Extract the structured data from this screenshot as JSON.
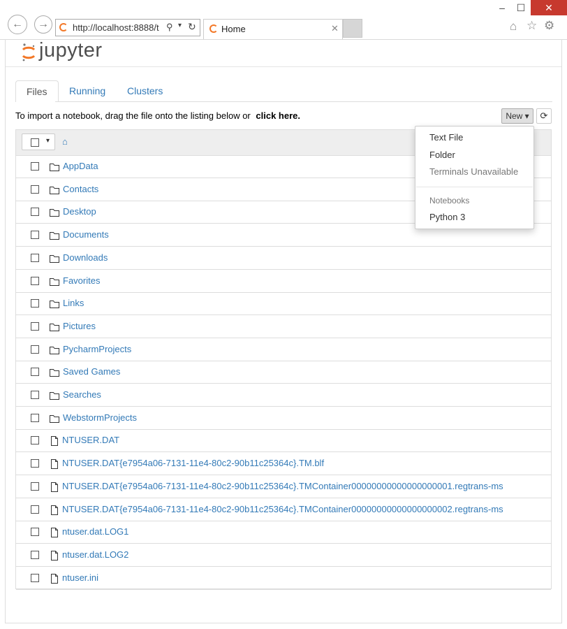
{
  "browser": {
    "address": "http://localhost:8888/t",
    "tab_title": "Home",
    "window_controls": {
      "minimize": "–",
      "maximize": "☐",
      "close": "✕"
    }
  },
  "app": {
    "logo_text": "jupyter"
  },
  "tabs": [
    {
      "label": "Files"
    },
    {
      "label": "Running"
    },
    {
      "label": "Clusters"
    }
  ],
  "import_bar": {
    "text": "To import a notebook, drag the file onto the listing below or",
    "link": "click here."
  },
  "toolbar": {
    "new_label": "New ▾"
  },
  "new_menu": {
    "items": [
      "Text File",
      "Folder"
    ],
    "disabled_item": "Terminals Unavailable",
    "section_header": "Notebooks",
    "kernels": [
      "Python 3"
    ]
  },
  "files": [
    {
      "name": "AppData",
      "type": "folder"
    },
    {
      "name": "Contacts",
      "type": "folder"
    },
    {
      "name": "Desktop",
      "type": "folder"
    },
    {
      "name": "Documents",
      "type": "folder"
    },
    {
      "name": "Downloads",
      "type": "folder"
    },
    {
      "name": "Favorites",
      "type": "folder"
    },
    {
      "name": "Links",
      "type": "folder"
    },
    {
      "name": "Pictures",
      "type": "folder"
    },
    {
      "name": "PycharmProjects",
      "type": "folder"
    },
    {
      "name": "Saved Games",
      "type": "folder"
    },
    {
      "name": "Searches",
      "type": "folder"
    },
    {
      "name": "WebstormProjects",
      "type": "folder"
    },
    {
      "name": "NTUSER.DAT",
      "type": "file"
    },
    {
      "name": "NTUSER.DAT{e7954a06-7131-11e4-80c2-90b11c25364c}.TM.blf",
      "type": "file"
    },
    {
      "name": "NTUSER.DAT{e7954a06-7131-11e4-80c2-90b11c25364c}.TMContainer00000000000000000001.regtrans-ms",
      "type": "file"
    },
    {
      "name": "NTUSER.DAT{e7954a06-7131-11e4-80c2-90b11c25364c}.TMContainer00000000000000000002.regtrans-ms",
      "type": "file"
    },
    {
      "name": "ntuser.dat.LOG1",
      "type": "file"
    },
    {
      "name": "ntuser.dat.LOG2",
      "type": "file"
    },
    {
      "name": "ntuser.ini",
      "type": "file"
    }
  ],
  "colors": {
    "link": "#337ab7",
    "jupyter_orange": "#f37726",
    "close_red": "#c7392e"
  }
}
